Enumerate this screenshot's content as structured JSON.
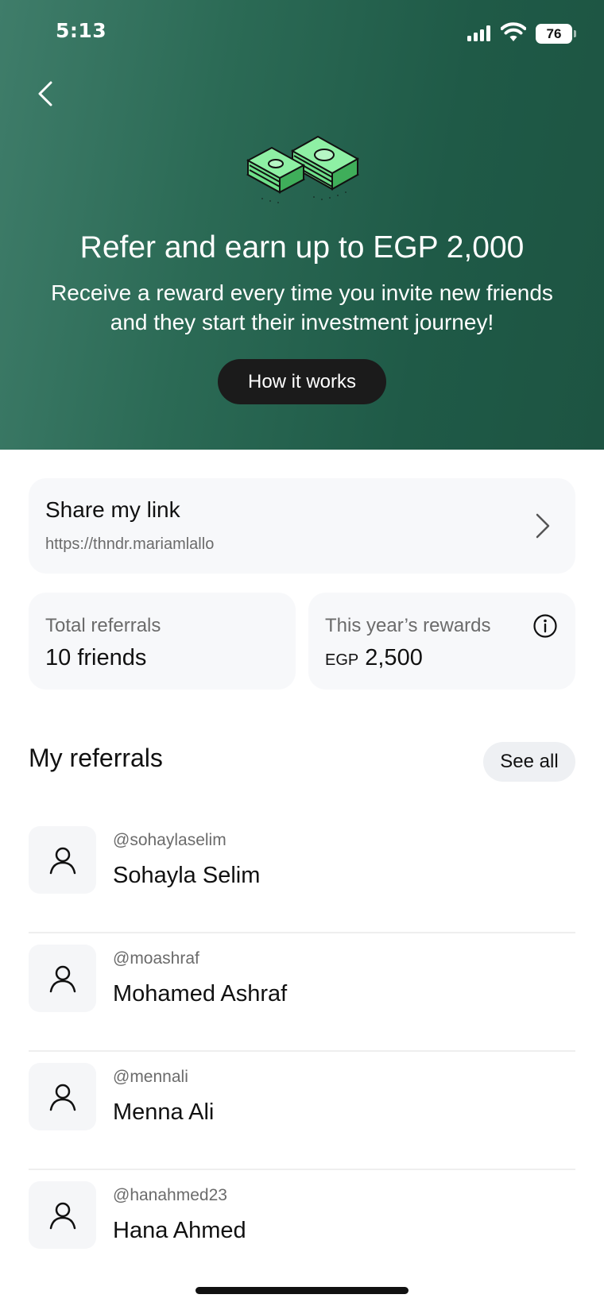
{
  "status_bar": {
    "time": "5:13",
    "battery": "76"
  },
  "hero": {
    "title": "Refer and earn up to EGP 2,000",
    "subtitle": "Receive a reward every time you invite new friends and they start their investment journey!",
    "button_label": "How it works",
    "background_color": "#2b6a55",
    "illustration_icon": "money-stack-icon"
  },
  "share": {
    "title": "Share my link",
    "link": "https://thndr.mariamlallo"
  },
  "stats": {
    "total_referrals_label": "Total referrals",
    "total_referrals_value": "10 friends",
    "rewards_label": "This year’s rewards",
    "rewards_currency": "EGP",
    "rewards_amount": "2,500"
  },
  "referrals": {
    "title": "My referrals",
    "see_all_label": "See all",
    "items": [
      {
        "handle": "@sohaylaselim",
        "name": "Sohayla Selim"
      },
      {
        "handle": "@moashraf",
        "name": "Mohamed Ashraf"
      },
      {
        "handle": "@mennali",
        "name": "Menna Ali"
      },
      {
        "handle": "@hanahmed23",
        "name": "Hana Ahmed"
      }
    ]
  }
}
